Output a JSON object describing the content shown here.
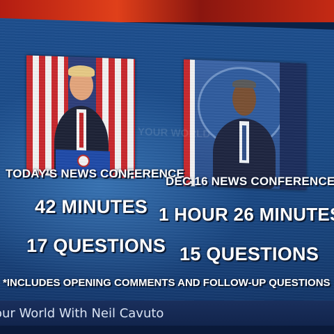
{
  "left_panel": {
    "heading": "TODAY'S NEWS CONFERENCE",
    "duration": "42 MINUTES",
    "questions": "17 QUESTIONS"
  },
  "right_panel": {
    "heading": "DEC 16 NEWS CONFERENCE",
    "duration": "1 HOUR 26 MINUTES",
    "questions": "15 QUESTIONS"
  },
  "footnote": "*INCLUDES OPENING COMMENTS AND FOLLOW-UP QUESTIONS",
  "ticker": {
    "show_title": "our World With Neil Cavuto"
  },
  "colors": {
    "screen_blue": "#1c4d8c",
    "flag_red": "#c8282d",
    "text": "#ffffff"
  },
  "icons": [
    "podium-seal-icon",
    "white-house-seal-icon"
  ]
}
